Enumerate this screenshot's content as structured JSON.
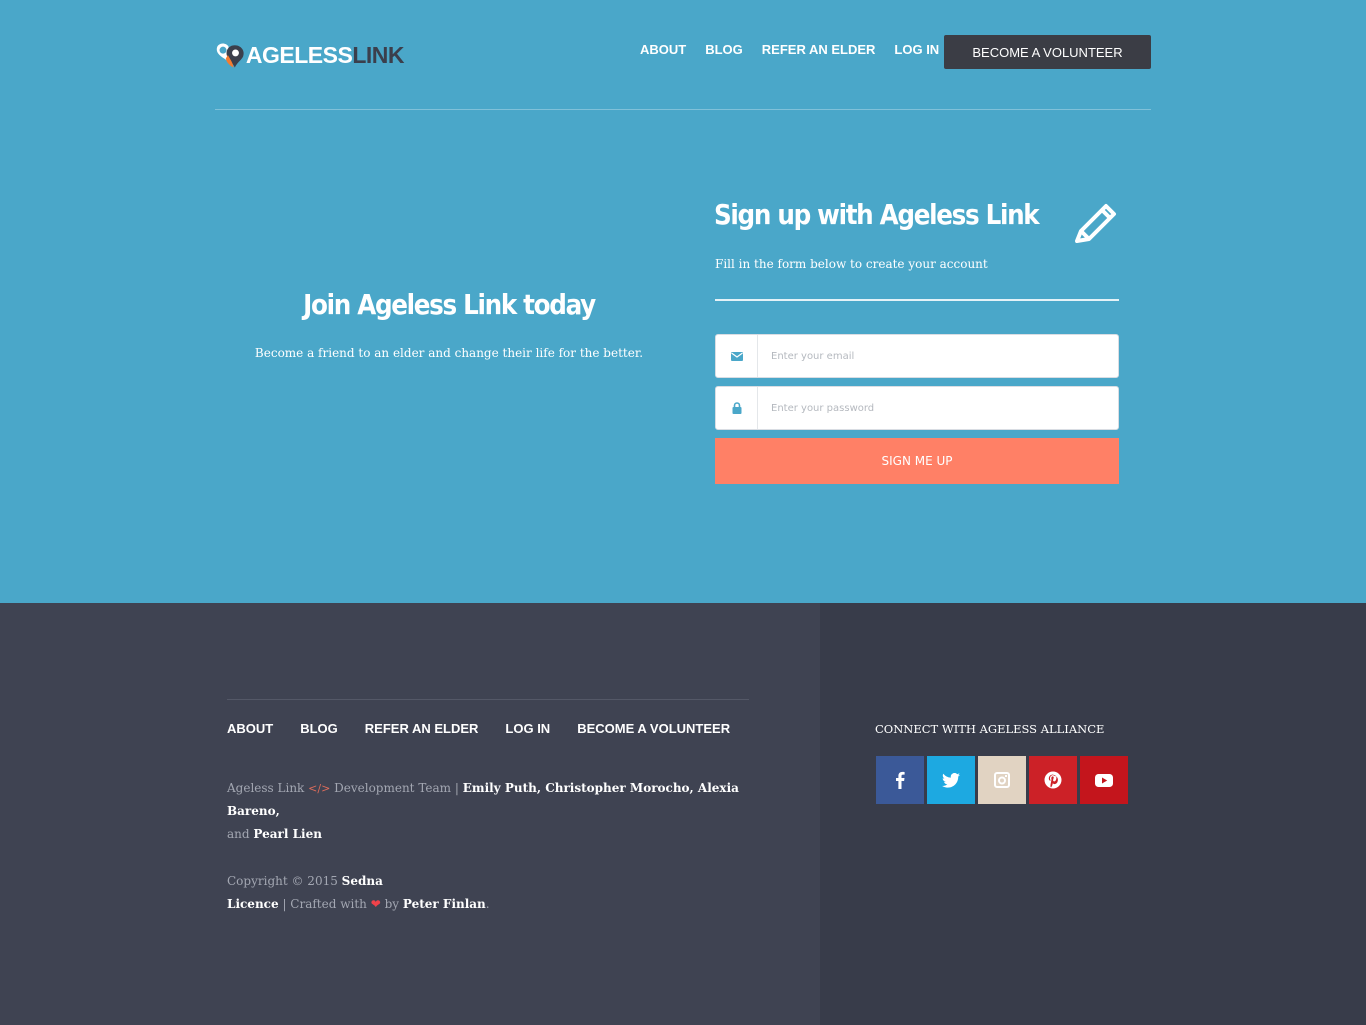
{
  "brand": {
    "name_light": "AGELESS",
    "name_dark": "LINK"
  },
  "nav": {
    "items": [
      "ABOUT",
      "BLOG",
      "REFER AN ELDER",
      "LOG IN"
    ],
    "cta": "BECOME A VOLUNTEER"
  },
  "hero": {
    "join_title": "Join Ageless Link today",
    "join_subtitle": "Become a friend to an elder and change their life for the better."
  },
  "signup": {
    "title": "Sign up with Ageless Link",
    "subtitle": "Fill in the form below to create your account",
    "email_placeholder": "Enter your email",
    "password_placeholder": "Enter your password",
    "submit_label": "SIGN ME UP"
  },
  "footer": {
    "nav": [
      "ABOUT",
      "BLOG",
      "REFER AN ELDER",
      "LOG IN",
      "BECOME A VOLUNTEER"
    ],
    "credits_prefix": "Ageless Link",
    "credits_team": "Development Team |",
    "credits_names": "Emily Puth, Christopher Morocho, Alexia Bareno,",
    "credits_and": "and",
    "credits_last": "Pearl Lien",
    "copyright": "Copyright © 2015",
    "copyright_owner": "Sedna",
    "licence": "Licence",
    "crafted": "| Crafted with",
    "by": "by",
    "author": "Peter Finlan",
    "connect_label": "CONNECT WITH AGELESS ALLIANCE",
    "socials": [
      {
        "icon": "facebook-icon",
        "color": "#3b5998"
      },
      {
        "icon": "twitter-icon",
        "color": "#1da9e1"
      },
      {
        "icon": "instagram-icon",
        "color": "#e1d3c2"
      },
      {
        "icon": "pinterest-icon",
        "color": "#cc2127"
      },
      {
        "icon": "youtube-icon",
        "color": "#c4151c"
      }
    ]
  },
  "colors": {
    "hero_bg": "#4aa7c9",
    "cta_bg": "#3b3d45",
    "submit_bg": "#ff8066",
    "footer_left_bg": "#3f4352",
    "footer_right_bg": "#383c4a"
  }
}
